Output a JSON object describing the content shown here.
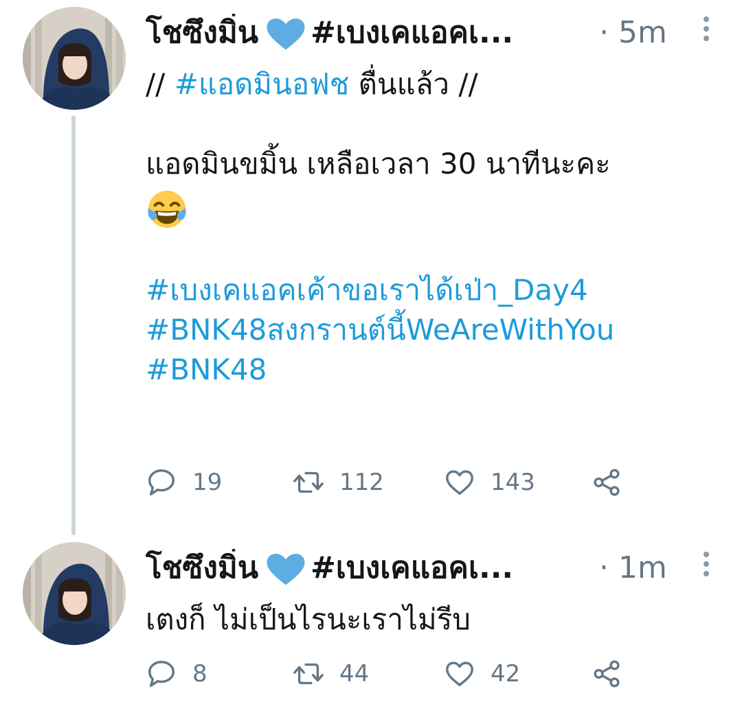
{
  "tweets": [
    {
      "user": {
        "name": "โชซึงมิ่น",
        "name_suffix": "#เบงเคแอคเ..."
      },
      "time": "5m",
      "text": {
        "line1_prefix": "// ",
        "line1_hashtag": "#แอดมินอฟช",
        "line1_suffix": " ตื่นแล้ว //",
        "line2": "แอดมินขมิ้น เหลือเวลา 30 นาทีนะคะ",
        "emoji": "face-with-tears-of-joy",
        "hashtags": [
          "#เบงเคแอคเค้าขอเราได้เป่า_Day4",
          "#BNK48สงกรานต์นี้WeAreWithYou",
          "#BNK48"
        ]
      },
      "stats": {
        "replies": "19",
        "retweets": "112",
        "likes": "143"
      }
    },
    {
      "user": {
        "name": "โชซึงมิ่น",
        "name_suffix": "#เบงเคแอคเ..."
      },
      "time": "1m",
      "text": {
        "line1": "เตงก็ ไม่เป็นไรนะเราไม่รีบ"
      },
      "stats": {
        "replies": "8",
        "retweets": "44",
        "likes": "42"
      }
    }
  ],
  "colors": {
    "hashtag": "#1d9bd9",
    "heart": "#5dade2",
    "muted": "#657786",
    "thread_line": "#ccd6dd"
  },
  "icons": {
    "reply": "reply-icon",
    "retweet": "retweet-icon",
    "like": "like-icon",
    "share": "share-icon",
    "more": "more-icon",
    "heart": "blue-heart-icon"
  }
}
